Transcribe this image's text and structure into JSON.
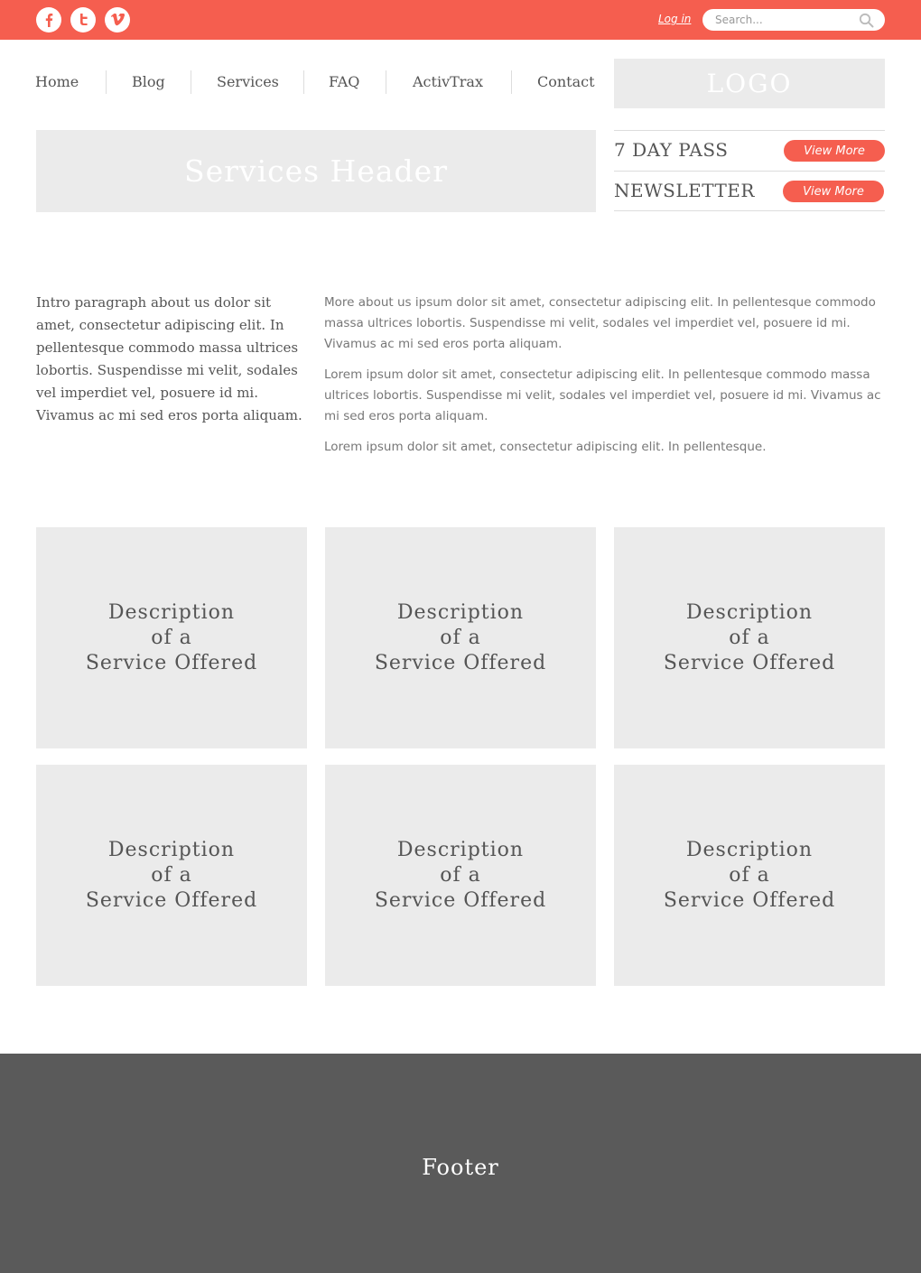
{
  "topbar": {
    "social": [
      {
        "name": "facebook-icon",
        "glyph": "f"
      },
      {
        "name": "twitter-icon",
        "glyph": "t"
      },
      {
        "name": "vimeo-icon",
        "glyph": "v"
      }
    ],
    "login_label": "Log in",
    "search_placeholder": "Search...",
    "accent_color": "#f55e4f"
  },
  "nav": {
    "items": [
      "Home",
      "Blog",
      "Services",
      "FAQ",
      "ActivTrax",
      "Contact"
    ]
  },
  "logo": {
    "text": "LOGO"
  },
  "header": {
    "title": "Services Header"
  },
  "side": {
    "rows": [
      {
        "label": "7 DAY PASS",
        "button": "View More"
      },
      {
        "label": "NEWSLETTER",
        "button": "View More"
      }
    ]
  },
  "intro": {
    "text": "Intro paragraph about us dolor sit amet, consectetur adipiscing elit. In pellentesque commodo massa ultrices lobortis. Suspendisse mi velit, sodales vel imperdiet vel, posuere id mi. Vivamus ac mi sed eros porta aliquam."
  },
  "body": {
    "paragraphs": [
      "More about us ipsum dolor sit amet, consectetur adipiscing elit. In pellentesque commodo massa ultrices lobortis. Suspendisse mi velit, sodales vel imperdiet vel, posuere id mi. Vivamus ac mi sed eros porta aliquam.",
      "Lorem ipsum dolor sit amet, consectetur adipiscing elit. In pellentesque commodo massa ultrices lobortis. Suspendisse mi velit, sodales vel imperdiet vel, posuere id mi. Vivamus ac mi sed eros porta aliquam.",
      "Lorem ipsum dolor sit amet, consectetur adipiscing elit. In pellentesque."
    ]
  },
  "services": {
    "items": [
      {
        "line1": "Description",
        "line2": "of a",
        "line3": "Service Offered"
      },
      {
        "line1": "Description",
        "line2": "of a",
        "line3": "Service Offered"
      },
      {
        "line1": "Description",
        "line2": "of a",
        "line3": "Service Offered"
      },
      {
        "line1": "Description",
        "line2": "of a",
        "line3": "Service Offered"
      },
      {
        "line1": "Description",
        "line2": "of a",
        "line3": "Service Offered"
      },
      {
        "line1": "Description",
        "line2": "of a",
        "line3": "Service Offered"
      }
    ]
  },
  "footer": {
    "label": "Footer"
  }
}
